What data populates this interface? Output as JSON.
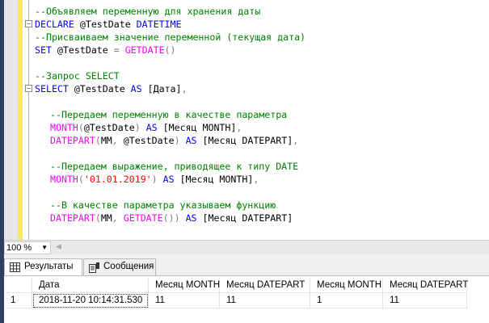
{
  "editor": {
    "lines": [
      {
        "indent": false,
        "fold": false,
        "tokens": [
          {
            "t": "c",
            "v": "--Объявляем переменную для хранения даты"
          }
        ]
      },
      {
        "indent": false,
        "fold": true,
        "tokens": [
          {
            "t": "k",
            "v": "DECLARE"
          },
          {
            "t": "n",
            "v": " @TestDate "
          },
          {
            "t": "k",
            "v": "DATETIME"
          }
        ]
      },
      {
        "indent": false,
        "fold": false,
        "tokens": [
          {
            "t": "c",
            "v": "--Присваиваем значение переменной (текущая дата)"
          }
        ]
      },
      {
        "indent": false,
        "fold": false,
        "tokens": [
          {
            "t": "k",
            "v": "SET"
          },
          {
            "t": "n",
            "v": " @TestDate "
          },
          {
            "t": "g",
            "v": "="
          },
          {
            "t": "n",
            "v": " "
          },
          {
            "t": "f",
            "v": "GETDATE"
          },
          {
            "t": "g",
            "v": "()"
          }
        ]
      },
      {
        "indent": false,
        "fold": false,
        "tokens": []
      },
      {
        "indent": false,
        "fold": false,
        "tokens": [
          {
            "t": "c",
            "v": "--Запрос SELECT"
          }
        ]
      },
      {
        "indent": false,
        "fold": true,
        "tokens": [
          {
            "t": "k",
            "v": "SELECT"
          },
          {
            "t": "n",
            "v": " @TestDate "
          },
          {
            "t": "k",
            "v": "AS"
          },
          {
            "t": "n",
            "v": " [Дата]"
          },
          {
            "t": "g",
            "v": ","
          }
        ]
      },
      {
        "indent": false,
        "fold": false,
        "tokens": []
      },
      {
        "indent": true,
        "fold": false,
        "tokens": [
          {
            "t": "c",
            "v": "--Передаем переменную в качестве параметра"
          }
        ]
      },
      {
        "indent": true,
        "fold": false,
        "tokens": [
          {
            "t": "f",
            "v": "MONTH"
          },
          {
            "t": "g",
            "v": "("
          },
          {
            "t": "n",
            "v": "@TestDate"
          },
          {
            "t": "g",
            "v": ")"
          },
          {
            "t": "n",
            "v": " "
          },
          {
            "t": "k",
            "v": "AS"
          },
          {
            "t": "n",
            "v": " [Месяц MONTH]"
          },
          {
            "t": "g",
            "v": ","
          }
        ]
      },
      {
        "indent": true,
        "fold": false,
        "tokens": [
          {
            "t": "f",
            "v": "DATEPART"
          },
          {
            "t": "g",
            "v": "("
          },
          {
            "t": "n",
            "v": "MM"
          },
          {
            "t": "g",
            "v": ","
          },
          {
            "t": "n",
            "v": " @TestDate"
          },
          {
            "t": "g",
            "v": ")"
          },
          {
            "t": "n",
            "v": " "
          },
          {
            "t": "k",
            "v": "AS"
          },
          {
            "t": "n",
            "v": " [Месяц DATEPART]"
          },
          {
            "t": "g",
            "v": ","
          }
        ]
      },
      {
        "indent": false,
        "fold": false,
        "tokens": []
      },
      {
        "indent": true,
        "fold": false,
        "tokens": [
          {
            "t": "c",
            "v": "--Передаем выражение, приводящее к типу DATE"
          }
        ]
      },
      {
        "indent": true,
        "fold": false,
        "tokens": [
          {
            "t": "f",
            "v": "MONTH"
          },
          {
            "t": "g",
            "v": "("
          },
          {
            "t": "s",
            "v": "'01.01.2019'"
          },
          {
            "t": "g",
            "v": ")"
          },
          {
            "t": "n",
            "v": " "
          },
          {
            "t": "k",
            "v": "AS"
          },
          {
            "t": "n",
            "v": " [Месяц MONTH]"
          },
          {
            "t": "g",
            "v": ","
          }
        ]
      },
      {
        "indent": false,
        "fold": false,
        "tokens": []
      },
      {
        "indent": true,
        "fold": false,
        "tokens": [
          {
            "t": "c",
            "v": "--В качестве параметра указываем функцию"
          }
        ]
      },
      {
        "indent": true,
        "fold": false,
        "tokens": [
          {
            "t": "f",
            "v": "DATEPART"
          },
          {
            "t": "g",
            "v": "("
          },
          {
            "t": "n",
            "v": "MM"
          },
          {
            "t": "g",
            "v": ","
          },
          {
            "t": "n",
            "v": " "
          },
          {
            "t": "f",
            "v": "GETDATE"
          },
          {
            "t": "g",
            "v": "())"
          },
          {
            "t": "n",
            "v": " "
          },
          {
            "t": "k",
            "v": "AS"
          },
          {
            "t": "n",
            "v": " [Месяц DATEPART]"
          }
        ]
      }
    ]
  },
  "zoom": {
    "value": "100 %"
  },
  "tabs": [
    {
      "label": "Результаты",
      "icon": "grid-icon"
    },
    {
      "label": "Сообщения",
      "icon": "messages-icon"
    }
  ],
  "results": {
    "columns": [
      "Дата",
      "Месяц MONTH",
      "Месяц DATEPART",
      "Месяц MONTH",
      "Месяц DATEPART"
    ],
    "rows": [
      {
        "num": "1",
        "cells": [
          "2018-11-20 10:14:31.530",
          "11",
          "11",
          "1",
          "11"
        ]
      }
    ]
  },
  "colors": {
    "keyword": "#0000ff",
    "function": "#ff00ff",
    "comment": "#008000",
    "string": "#ff0000",
    "operator": "#808080"
  }
}
